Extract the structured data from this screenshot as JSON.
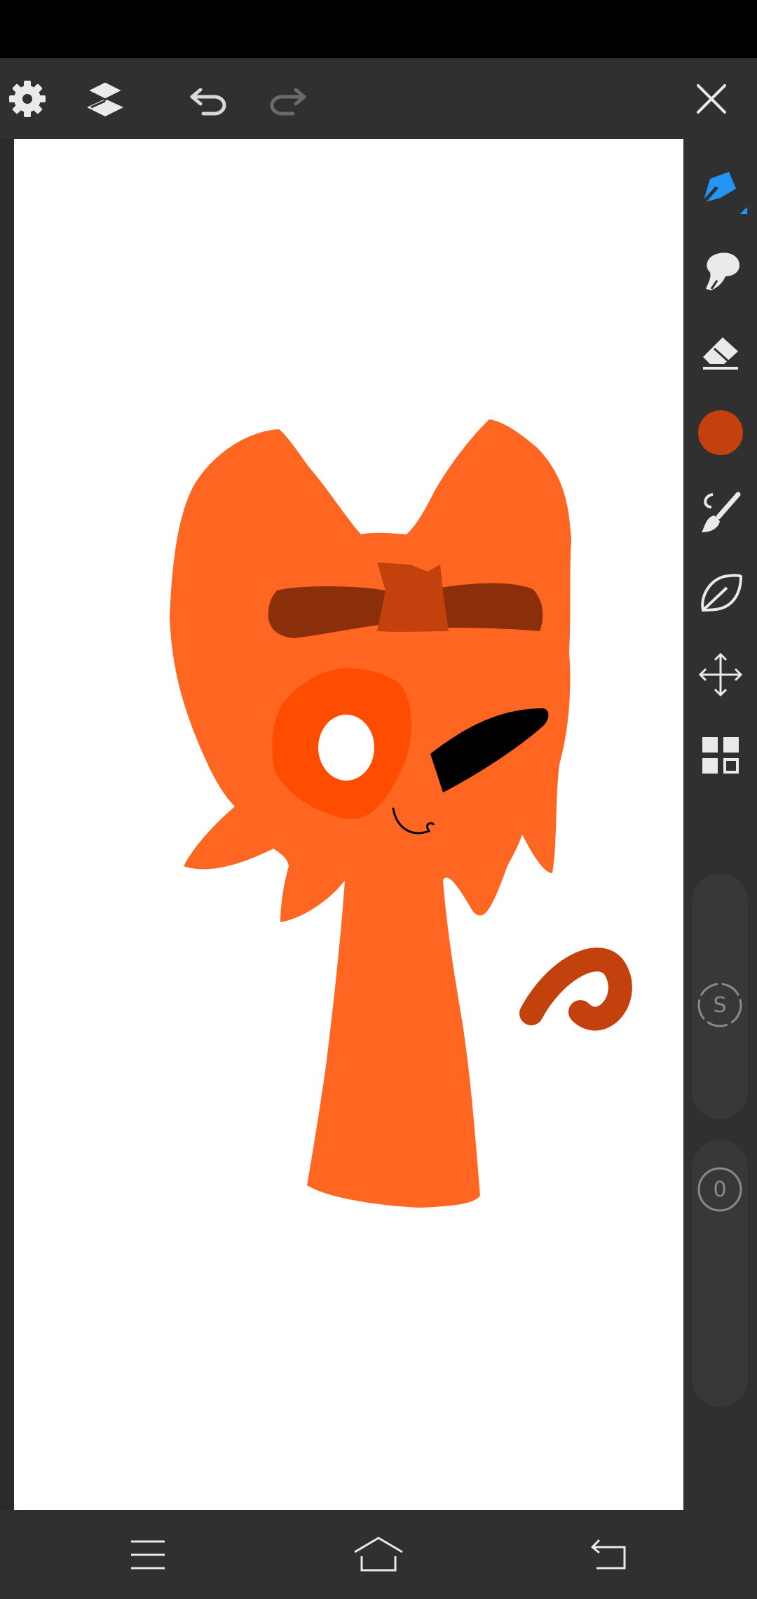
{
  "app": {
    "accent_color": "#2196F3",
    "background_color": "#303030"
  },
  "status_bar": {
    "color": "#000000"
  },
  "top_toolbar": {
    "buttons": [
      {
        "name": "settings",
        "icon": "gear-icon",
        "enabled": true
      },
      {
        "name": "layers",
        "icon": "layers-icon",
        "enabled": true
      },
      {
        "name": "undo",
        "icon": "undo-icon",
        "enabled": true
      },
      {
        "name": "redo",
        "icon": "redo-icon",
        "enabled": false
      },
      {
        "name": "close",
        "icon": "close-icon",
        "enabled": true
      }
    ]
  },
  "tools": [
    {
      "name": "pen",
      "icon": "pen-icon",
      "selected": true
    },
    {
      "name": "smudge",
      "icon": "smudge-icon",
      "selected": false
    },
    {
      "name": "eraser",
      "icon": "eraser-icon",
      "selected": false
    },
    {
      "name": "color",
      "icon": "color-swatch",
      "selected": false
    },
    {
      "name": "brush",
      "icon": "brush-icon",
      "selected": false
    },
    {
      "name": "lasso",
      "icon": "lasso-icon",
      "selected": false
    },
    {
      "name": "transform",
      "icon": "move-icon",
      "selected": false
    },
    {
      "name": "grid",
      "icon": "grid-icon",
      "selected": false
    }
  ],
  "current_color": "#C2410C",
  "sliders": {
    "size": {
      "badge": "S",
      "icon": "size-icon"
    },
    "opacity": {
      "badge": "0",
      "icon": "opacity-icon"
    }
  },
  "canvas": {
    "background": "#FFFFFF",
    "drawing_colors": {
      "body": "#FF6622",
      "brows": "#8B2E0A",
      "patch": "#C2410C",
      "eye_ring": "#FF4D00",
      "eye_black": "#000000"
    }
  },
  "nav_bar": {
    "buttons": [
      {
        "name": "menu",
        "icon": "menu-icon"
      },
      {
        "name": "home",
        "icon": "home-icon"
      },
      {
        "name": "back",
        "icon": "back-icon"
      }
    ]
  }
}
